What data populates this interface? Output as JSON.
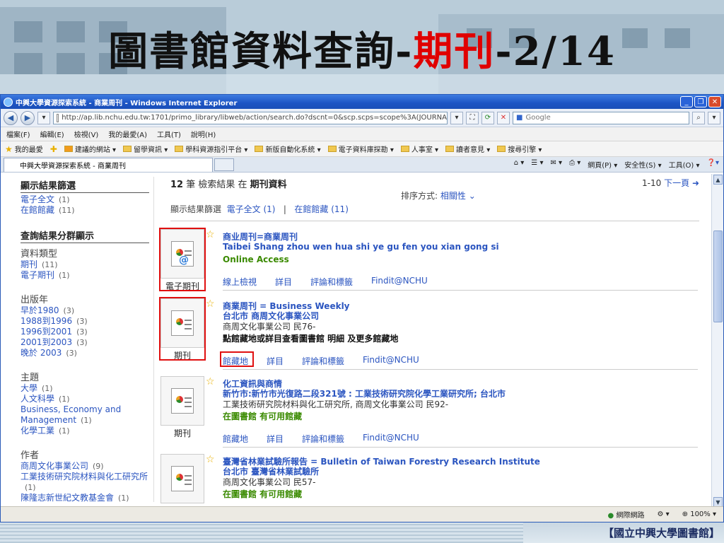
{
  "slide": {
    "title_part1": "圖書館資料查詢-",
    "title_part2": "期刊",
    "title_part3": "-2/14",
    "footer_label": "【國立中興大學圖書館】"
  },
  "browser": {
    "window_title": "中興大學資源探索系統 - 商業周刊 - Windows Internet Explorer",
    "url": "http://ap.lib.nchu.edu.tw:1701/primo_library/libweb/action/search.do?dscnt=0&scp.scps=scope%3A(JOURNA",
    "search_placeholder": "Google",
    "menu": [
      "檔案(F)",
      "編輯(E)",
      "檢視(V)",
      "我的最愛(A)",
      "工具(T)",
      "說明(H)"
    ],
    "favorites_label": "我的最愛",
    "favorites": [
      "建議的網站 ▾",
      "留學資訊 ▾",
      "學科資源指引平台 ▾",
      "新版自動化系統 ▾",
      "電子資料庫探勘 ▾",
      "人事室 ▾",
      "讀者意見 ▾",
      "搜尋引擎 ▾"
    ],
    "tab_title": "中興大學資源探索系統 - 商業周刊",
    "tools": [
      "網頁(P) ▾",
      "安全性(S) ▾",
      "工具(O) ▾"
    ],
    "status": {
      "zone": "網際網路",
      "zoom": "100%"
    }
  },
  "sidebar": {
    "sec1_title": "顯示結果篩選",
    "sec1_items": [
      {
        "label": "電子全文",
        "count": "(1)"
      },
      {
        "label": "在館館藏",
        "count": "(11)"
      }
    ],
    "sec2_title": "查詢結果分群顯示",
    "groups": [
      {
        "name": "資料類型",
        "items": [
          {
            "label": "期刊",
            "count": "(11)"
          },
          {
            "label": "電子期刊",
            "count": "(1)"
          }
        ]
      },
      {
        "name": "出版年",
        "items": [
          {
            "label": "早於1980",
            "count": "(3)"
          },
          {
            "label": "1988到1996",
            "count": "(3)"
          },
          {
            "label": "1996到2001",
            "count": "(3)"
          },
          {
            "label": "2001到2003",
            "count": "(3)"
          },
          {
            "label": "晚於 2003",
            "count": "(3)"
          }
        ]
      },
      {
        "name": "主題",
        "items": [
          {
            "label": "大學",
            "count": "(1)"
          },
          {
            "label": "人文科學",
            "count": "(1)"
          },
          {
            "label": "Business, Economy and Management",
            "count": "(1)"
          },
          {
            "label": "化學工業",
            "count": "(1)"
          }
        ]
      },
      {
        "name": "作者",
        "items": [
          {
            "label": "商周文化事業公司",
            "count": "(9)"
          },
          {
            "label": "工業技術研究院材料與化工研究所",
            "count": "(1)"
          },
          {
            "label": "陳隆志新世紀文教基金會",
            "count": "(1)"
          }
        ]
      }
    ]
  },
  "results": {
    "count": "12",
    "count_suffix": "筆 檢索結果 在",
    "scope": "期刊資料",
    "pager_range": "1-10",
    "pager_next": "下一頁",
    "sort_label": "排序方式:",
    "sort_value": "相關性",
    "filter_label": "顯示結果篩選",
    "filter_items": [
      "電子全文 (1)",
      "在館館藏 (11)"
    ],
    "items": [
      {
        "type_label": "電子期刊",
        "title": "商业周刊=商業周刊",
        "line2": "Taibei Shang zhou wen hua shi ye gu fen you xian gong si",
        "line3": "Online Access",
        "links": [
          "線上檢視",
          "詳目",
          "評論和標籤",
          "Findit@NCHU"
        ]
      },
      {
        "type_label": "期刊",
        "title": "商業周刊 = Business Weekly",
        "line2": "台北市 商周文化事業公司",
        "line3": "商周文化事業公司 民76-",
        "line4": "點館藏地或詳目查看圖書館 明細 及更多館藏地",
        "links": [
          "館藏地",
          "詳目",
          "評論和標籤",
          "Findit@NCHU"
        ]
      },
      {
        "type_label": "期刊",
        "title": "化工資訊與商情",
        "line2": "新竹市:新竹市光復路二段321號 : 工業技術研究院化學工業研究所; 台北市",
        "line3": "工業技術研究院材料與化工研究所, 商周文化事業公司 民92-",
        "line4": "在圖書館  有可用館藏",
        "links": [
          "館藏地",
          "詳目",
          "評論和標籤",
          "Findit@NCHU"
        ]
      },
      {
        "type_label": "",
        "title": "臺灣省林業試驗所報告 = Bulletin of Taiwan Forestry Research Institute",
        "line2": "台北市 臺灣省林業試驗所",
        "line3": "商周文化事業公司 民57-",
        "line4": "在圖書館  有可用館藏"
      }
    ]
  }
}
